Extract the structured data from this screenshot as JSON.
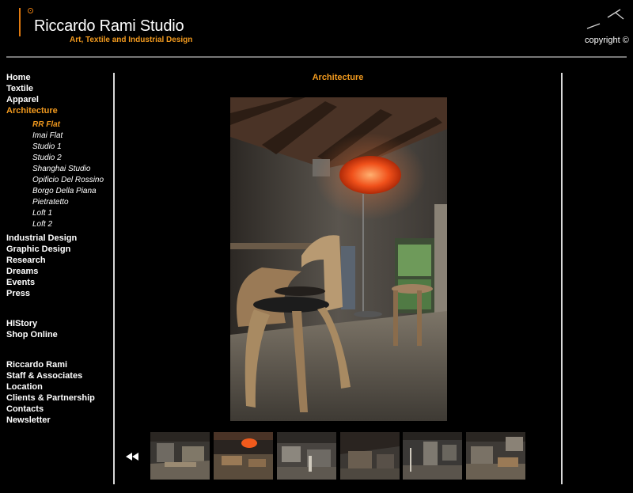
{
  "header": {
    "title": "Riccardo Rami Studio",
    "subtitle": "Art, Textile and Industrial Design",
    "copyright": "copyright ©"
  },
  "nav": {
    "main": [
      "Home",
      "Textile",
      "Apparel",
      "Architecture"
    ],
    "architecture_sub": [
      "RR Flat",
      "Imai Flat",
      "Studio 1",
      "Studio 2",
      "Shanghai Studio",
      "Opificio Del Rossino",
      "Borgo Della Piana",
      "Pietratetto",
      "Loft 1",
      "Loft 2"
    ],
    "after": [
      "Industrial Design",
      "Graphic Design",
      "Research",
      "Dreams",
      "Events",
      "Press"
    ],
    "group2": [
      "HIStory",
      "Shop Online"
    ],
    "group3": [
      "Riccardo Rami",
      "Staff & Associates",
      "Location",
      "Clients & Partnership",
      "Contacts",
      "Newsletter"
    ],
    "active_item": "Architecture",
    "active_sub": "RR Flat"
  },
  "main": {
    "section_title": "Architecture",
    "prev_icon": "rewind-icon",
    "thumbnails": 6
  },
  "colors": {
    "accent": "#f29a1e",
    "background": "#000000",
    "rule": "#d8d8d8"
  }
}
